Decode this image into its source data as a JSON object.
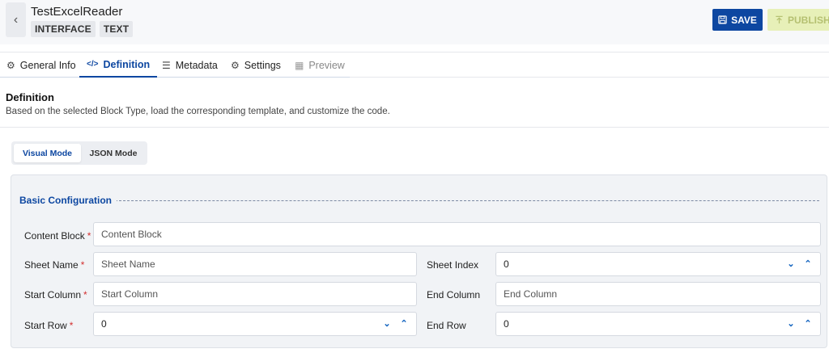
{
  "header": {
    "back_icon": "chevron-left-icon",
    "title": "TestExcelReader",
    "badges": [
      "INTERFACE",
      "TEXT"
    ],
    "save_label": "SAVE",
    "publish_label": "PUBLISH",
    "save_color": "#0d47a1",
    "publish_color": "#e7f0b8"
  },
  "tabs": [
    {
      "label": "General Info",
      "icon": "gear-icon"
    },
    {
      "label": "Definition",
      "icon": "code-icon"
    },
    {
      "label": "Metadata",
      "icon": "metadata-icon"
    },
    {
      "label": "Settings",
      "icon": "settings-icon"
    },
    {
      "label": "Preview",
      "icon": "preview-icon"
    }
  ],
  "section": {
    "title": "Definition",
    "description": "Based on the selected Block Type, load the corresponding template, and customize the code."
  },
  "modes": {
    "visual": "Visual Mode",
    "json": "JSON Mode",
    "selected": "Visual Mode"
  },
  "config": {
    "title": "Basic Configuration",
    "fields": {
      "content_block": {
        "label": "Content Block",
        "placeholder": "Content Block",
        "required": true
      },
      "sheet_name": {
        "label": "Sheet Name",
        "placeholder": "Sheet Name",
        "required": true
      },
      "sheet_index": {
        "label": "Sheet Index",
        "value": "0",
        "required": false
      },
      "start_column": {
        "label": "Start Column",
        "placeholder": "Start Column",
        "required": true
      },
      "end_column": {
        "label": "End Column",
        "placeholder": "End Column",
        "required": false
      },
      "start_row": {
        "label": "Start Row",
        "value": "0",
        "required": true
      },
      "end_row": {
        "label": "End Row",
        "value": "0",
        "required": false
      }
    },
    "required_mark": "*"
  }
}
